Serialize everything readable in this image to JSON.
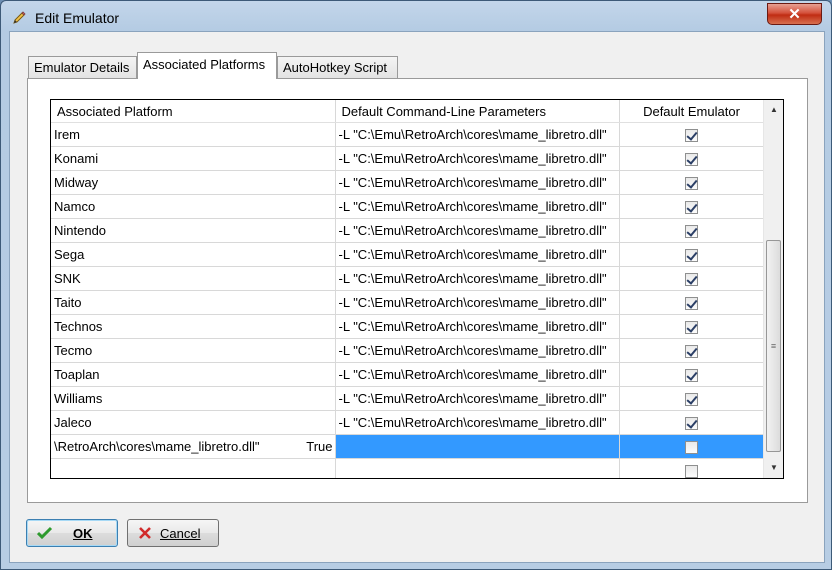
{
  "window": {
    "title": "Edit Emulator",
    "close_glyph": "✕"
  },
  "tabs": [
    {
      "label": "Emulator Details",
      "active": false
    },
    {
      "label": "Associated Platforms",
      "active": true
    },
    {
      "label": "AutoHotkey Script",
      "active": false
    }
  ],
  "grid": {
    "columns": [
      "Associated Platform",
      "Default Command-Line Parameters",
      "Default Emulator"
    ],
    "rows": [
      {
        "platform": "Irem",
        "params": "-L \"C:\\Emu\\RetroArch\\cores\\mame_libretro.dll\"",
        "default": true
      },
      {
        "platform": "Konami",
        "params": "-L \"C:\\Emu\\RetroArch\\cores\\mame_libretro.dll\"",
        "default": true
      },
      {
        "platform": "Midway",
        "params": "-L \"C:\\Emu\\RetroArch\\cores\\mame_libretro.dll\"",
        "default": true
      },
      {
        "platform": "Namco",
        "params": "-L \"C:\\Emu\\RetroArch\\cores\\mame_libretro.dll\"",
        "default": true
      },
      {
        "platform": "Nintendo",
        "params": "-L \"C:\\Emu\\RetroArch\\cores\\mame_libretro.dll\"",
        "default": true
      },
      {
        "platform": "Sega",
        "params": "-L \"C:\\Emu\\RetroArch\\cores\\mame_libretro.dll\"",
        "default": true
      },
      {
        "platform": "SNK",
        "params": "-L \"C:\\Emu\\RetroArch\\cores\\mame_libretro.dll\"",
        "default": true
      },
      {
        "platform": "Taito",
        "params": "-L \"C:\\Emu\\RetroArch\\cores\\mame_libretro.dll\"",
        "default": true
      },
      {
        "platform": "Technos",
        "params": "-L \"C:\\Emu\\RetroArch\\cores\\mame_libretro.dll\"",
        "default": true
      },
      {
        "platform": "Tecmo",
        "params": "-L \"C:\\Emu\\RetroArch\\cores\\mame_libretro.dll\"",
        "default": true
      },
      {
        "platform": "Toaplan",
        "params": "-L \"C:\\Emu\\RetroArch\\cores\\mame_libretro.dll\"",
        "default": true
      },
      {
        "platform": "Williams",
        "params": "-L \"C:\\Emu\\RetroArch\\cores\\mame_libretro.dll\"",
        "default": true
      },
      {
        "platform": "Jaleco",
        "params": "-L \"C:\\Emu\\RetroArch\\cores\\mame_libretro.dll\"",
        "default": true
      }
    ],
    "edit_row": {
      "platform_value": "\\RetroArch\\cores\\mame_libretro.dll\"",
      "platform_suffix": "True",
      "default": false
    },
    "new_row": {
      "default": false
    },
    "highlight_color": "#3399ff"
  },
  "buttons": {
    "ok": "OK",
    "cancel": "Cancel"
  },
  "icons": {
    "title": "pencil-icon",
    "ok": "checkmark-icon",
    "cancel": "red-x-icon"
  }
}
